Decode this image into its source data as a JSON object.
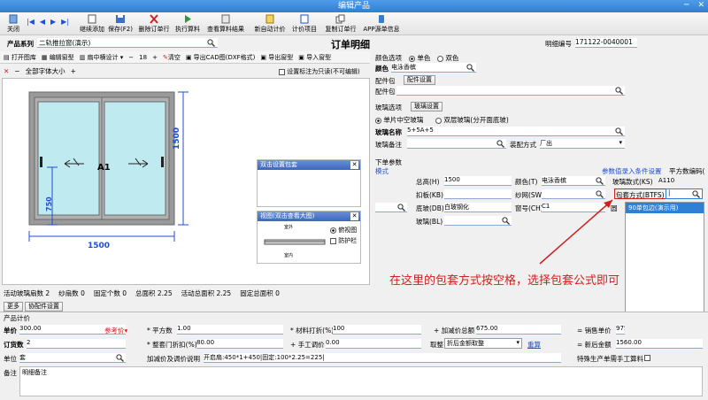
{
  "window": {
    "title": "编辑产品"
  },
  "toolbar": {
    "close": "关闭",
    "continue_add": "继续添加",
    "save": "保存(F2)",
    "delete_item": "删除订单行",
    "run_calc": "执行算料",
    "view_calc": "查看算料结果",
    "auto_price": "新自动计价",
    "price_item": "计价项目",
    "copy_row": "复制订单行",
    "app_info": "APP源单信息"
  },
  "left": {
    "series_label": "产品系列",
    "series_value": "二轨推拉窗(演示)",
    "tools": {
      "open_lib": "打开图库",
      "edit_shape": "编辑窗型",
      "mullion": "扇中横设计",
      "num": "18",
      "clear": "清空",
      "export_cad": "导出CAD图(DXF格式)",
      "export_shape": "导出窗型",
      "import_shape": "导入窗型"
    },
    "font_size": "全部字体大小",
    "readonly_label": "设置标注为只读(不可编辑)",
    "drawing": {
      "width": "1500",
      "height": "1500",
      "inner_height": "750",
      "label": "A1"
    },
    "popup_detail": "双击设置包套",
    "popup_view": "视图(双击查看大图)",
    "popup_view_opts": [
      "俯视图",
      "防护栏"
    ],
    "popup_view_labels": [
      "室外",
      "室内"
    ],
    "stats": [
      {
        "label": "活动玻璃扇数",
        "value": "2"
      },
      {
        "label": "纱扇数",
        "value": "0"
      },
      {
        "label": "固定个数",
        "value": "0"
      },
      {
        "label": "总面积",
        "value": "2.25"
      },
      {
        "label": "活动总面积",
        "value": "2.25"
      },
      {
        "label": "固定总面积",
        "value": "0"
      }
    ],
    "more": "更多",
    "part_settings": "协配件设置"
  },
  "right": {
    "title": "订单明细",
    "detail_no_label": "明细编号",
    "detail_no": "171122-0040001",
    "color_opts_label": "颜色选项",
    "color_single": "单色",
    "color_double": "双色",
    "color_label": "颜色",
    "color_value": "电泳香槟",
    "parts_label": "配件包",
    "parts_btn": "配件设置",
    "parts2_label": "配件包",
    "glass_opts_label": "玻璃选项",
    "glass_btn": "玻璃设置",
    "glass_single": "单片中空玻璃",
    "glass_double": "双层玻璃(分开面底玻)",
    "glass_name_label": "玻璃名称",
    "glass_name_value": "5+5A+5",
    "glass_note_label": "玻璃备注",
    "install_label": "装配方式",
    "install_value": "厂出",
    "order_params": "下单参数",
    "mode": "模式",
    "params": [
      {
        "label": "总高(H)",
        "value": "1500"
      },
      {
        "label": "颜色(T)",
        "value": "电泳香槟"
      },
      {
        "label": "扣板(KB)",
        "value": ""
      },
      {
        "label": "纱网(SW)",
        "value": ""
      },
      {
        "label": "底玻(DB)",
        "value": "白玻钢化"
      },
      {
        "label": "窗号(CH)",
        "value": "C1"
      },
      {
        "label": "玻璃(BL)",
        "value": ""
      }
    ],
    "cond_link": "参数值录入条件设置",
    "square_code": "平方数编码(",
    "glass_style_label": "玻璃款式(KS)",
    "glass_style_value": "A110",
    "package_label": "包套方式(BTFS)",
    "package_value": "|",
    "dropdown_item": "90单包边(演示用)",
    "annotation": "在这里的包套方式按空格，选择包套公式即可",
    "add_btn": "添加",
    "manage_btn": "管理"
  },
  "bottom": {
    "title": "产品计价",
    "unit_price_label": "单价",
    "unit_price": "300.00",
    "ref_price": "参考价",
    "area_label": "平方数",
    "area": "1.00",
    "material_discount_label": "材料打折(%)",
    "material_discount": "100",
    "add_price_total_label": "加减价总额",
    "add_price_total": "675.00",
    "sale_unit_label": "销售单价",
    "sale_unit": "975",
    "order_qty_label": "订货数",
    "order_qty": "2",
    "discount_label": "整套门折扣(%)",
    "discount": "80.00",
    "manual_label": "手工调价",
    "manual": "0.00",
    "rounding_label": "取整",
    "rounding_value": "折后金额取整",
    "recalc": "重算",
    "after_total_label": "新后金额",
    "after_total": "1560.00",
    "unit_label": "单位",
    "unit": "套",
    "price_note_label": "加减价及调价说明",
    "price_note": "开启扇:450*1+450|固定:100*2.25=225|",
    "special_label": "特殊生产单需手工算料",
    "remark_label": "备注",
    "remark": "明细备注"
  },
  "colors": {
    "accent": "#2f7fd4",
    "glass": "#bfeaf0",
    "frame": "#9a9a9a",
    "annotation": "#d02020"
  }
}
